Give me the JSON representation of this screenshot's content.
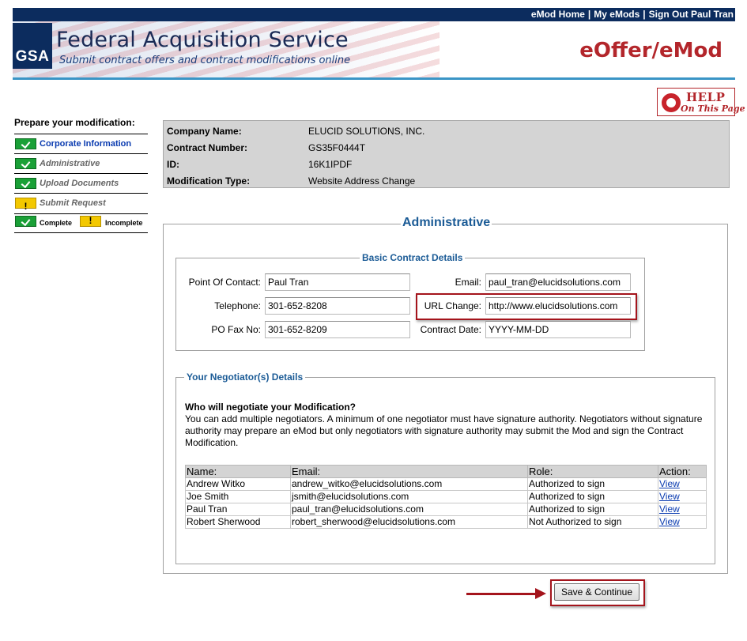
{
  "topnav": {
    "emod_home": "eMod Home",
    "my_emods": "My eMods",
    "sign_out": "Sign Out Paul Tran",
    "separator": "|"
  },
  "banner": {
    "logo_text": "GSA",
    "title": "Federal Acquisition Service",
    "subtitle": "Submit contract offers and contract modifications online",
    "brand": "eOffer/eMod"
  },
  "help": {
    "title": "HELP",
    "subtitle": "On This Page",
    "icon": "lifebuoy-icon"
  },
  "sidebar": {
    "title": "Prepare your modification:",
    "steps": [
      {
        "label": "Corporate Information",
        "status": "complete",
        "active": true
      },
      {
        "label": "Administrative",
        "status": "complete",
        "active": false
      },
      {
        "label": "Upload Documents",
        "status": "complete",
        "active": false
      },
      {
        "label": "Submit Request",
        "status": "incomplete",
        "active": false
      }
    ],
    "legend": {
      "complete": "Complete",
      "incomplete": "Incomplete"
    }
  },
  "info": {
    "company_name_label": "Company Name:",
    "company_name": "ELUCID SOLUTIONS, INC.",
    "contract_number_label": "Contract Number:",
    "contract_number": "GS35F0444T",
    "id_label": "ID:",
    "id": "16K1IPDF",
    "mod_type_label": "Modification Type:",
    "mod_type": "Website Address Change"
  },
  "admin": {
    "title": "Administrative",
    "basic": {
      "title": "Basic Contract Details",
      "poc_label": "Point Of Contact:",
      "poc": "Paul Tran",
      "email_label": "Email:",
      "email": "paul_tran@elucidsolutions.com",
      "telephone_label": "Telephone:",
      "telephone": "301-652-8208",
      "url_label": "URL Change:",
      "url": "http://www.elucidsolutions.com",
      "fax_label": "PO Fax No:",
      "fax": "301-652-8209",
      "contract_date_label": "Contract Date:",
      "contract_date": "YYYY-MM-DD"
    },
    "negotiators": {
      "title": "Your Negotiator(s) Details",
      "question": "Who will negotiate your Modification?",
      "description": "You can add multiple negotiators. A minimum of one negotiator must have signature authority. Negotiators without signature authority may prepare an eMod but only negotiators with signature authority may submit the Mod and sign the Contract Modification.",
      "columns": [
        "Name:",
        "Email:",
        "Role:",
        "Action:"
      ],
      "rows": [
        {
          "name": "Andrew Witko",
          "email": "andrew_witko@elucidsolutions.com",
          "role": "Authorized to sign",
          "action": "View"
        },
        {
          "name": "Joe Smith",
          "email": "jsmith@elucidsolutions.com",
          "role": "Authorized to sign",
          "action": "View"
        },
        {
          "name": "Paul Tran",
          "email": "paul_tran@elucidsolutions.com",
          "role": "Authorized to sign",
          "action": "View"
        },
        {
          "name": "Robert Sherwood",
          "email": "robert_sherwood@elucidsolutions.com",
          "role": "Not Authorized to sign",
          "action": "View"
        }
      ]
    }
  },
  "actions": {
    "save": "Save & Continue"
  },
  "colors": {
    "nav_bg": "#0c2c5e",
    "accent_blue": "#1b5b96",
    "brand_red": "#b3262b",
    "highlight_red": "#a4141c",
    "complete_green": "#1aa037",
    "incomplete_yellow": "#f3c800"
  }
}
